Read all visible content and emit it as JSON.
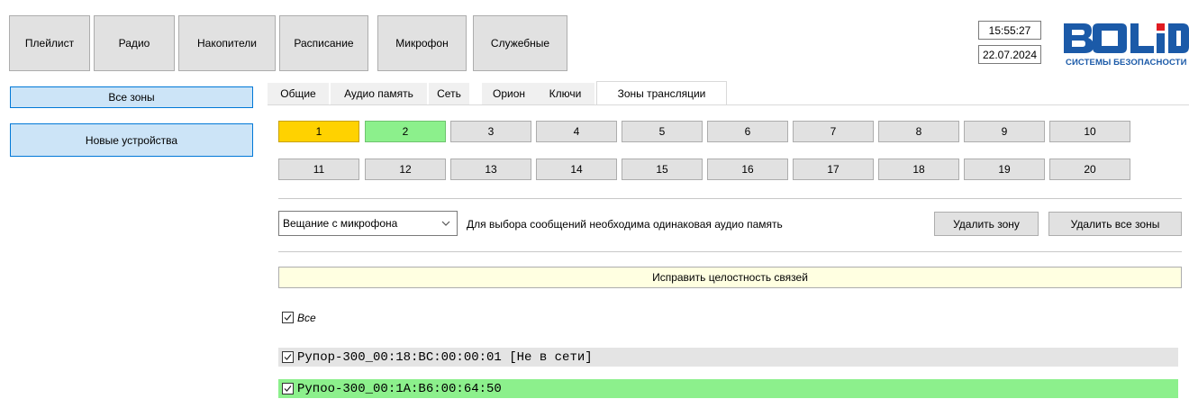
{
  "toolbar": {
    "playlist": "Плейлист",
    "radio": "Радио",
    "drives": "Накопители",
    "schedule": "Расписание",
    "microphone": "Микрофон",
    "service": "Служебные"
  },
  "status": {
    "time": "15:55:27",
    "date": "22.07.2024"
  },
  "logo": {
    "word": "BOLID",
    "subtitle": "СИСТЕМЫ БЕЗОПАСНОСТИ",
    "color": "#1b5aa8"
  },
  "sidebar": {
    "all_zones": "Все зоны",
    "new_devices": "Новые устройства"
  },
  "tabs": [
    "Общие",
    "Аудио память",
    "Сеть",
    "Орион",
    "Ключи",
    "Зоны трансляции"
  ],
  "active_tab": "Зоны трансляции",
  "zones": {
    "row1": [
      "1",
      "2",
      "3",
      "4",
      "5",
      "6",
      "7",
      "8",
      "9",
      "10"
    ],
    "row2": [
      "11",
      "12",
      "13",
      "14",
      "15",
      "16",
      "17",
      "18",
      "19",
      "20"
    ],
    "selected_zone": "1",
    "selected_color": "#ffd200",
    "active_zone": "2",
    "active_color": "#8cf08c"
  },
  "controls": {
    "mode_select": "Вещание с микрофона",
    "hint": "Для выбора сообщений необходима одинаковая аудио память",
    "delete_zone": "Удалить зону",
    "delete_all_zones": "Удалить все зоны",
    "fix_links": "Исправить целостность связей"
  },
  "device_list": {
    "all_label": "Все",
    "all_checked": true,
    "devices": [
      {
        "label": "Рупор-300_00:18:BC:00:00:01 [Не в сети]",
        "checked": true,
        "bg": "#e4e4e4"
      },
      {
        "label": "Рупоо-300_00:1A:B6:00:64:50",
        "checked": true,
        "bg": "#8cf08c"
      }
    ]
  }
}
